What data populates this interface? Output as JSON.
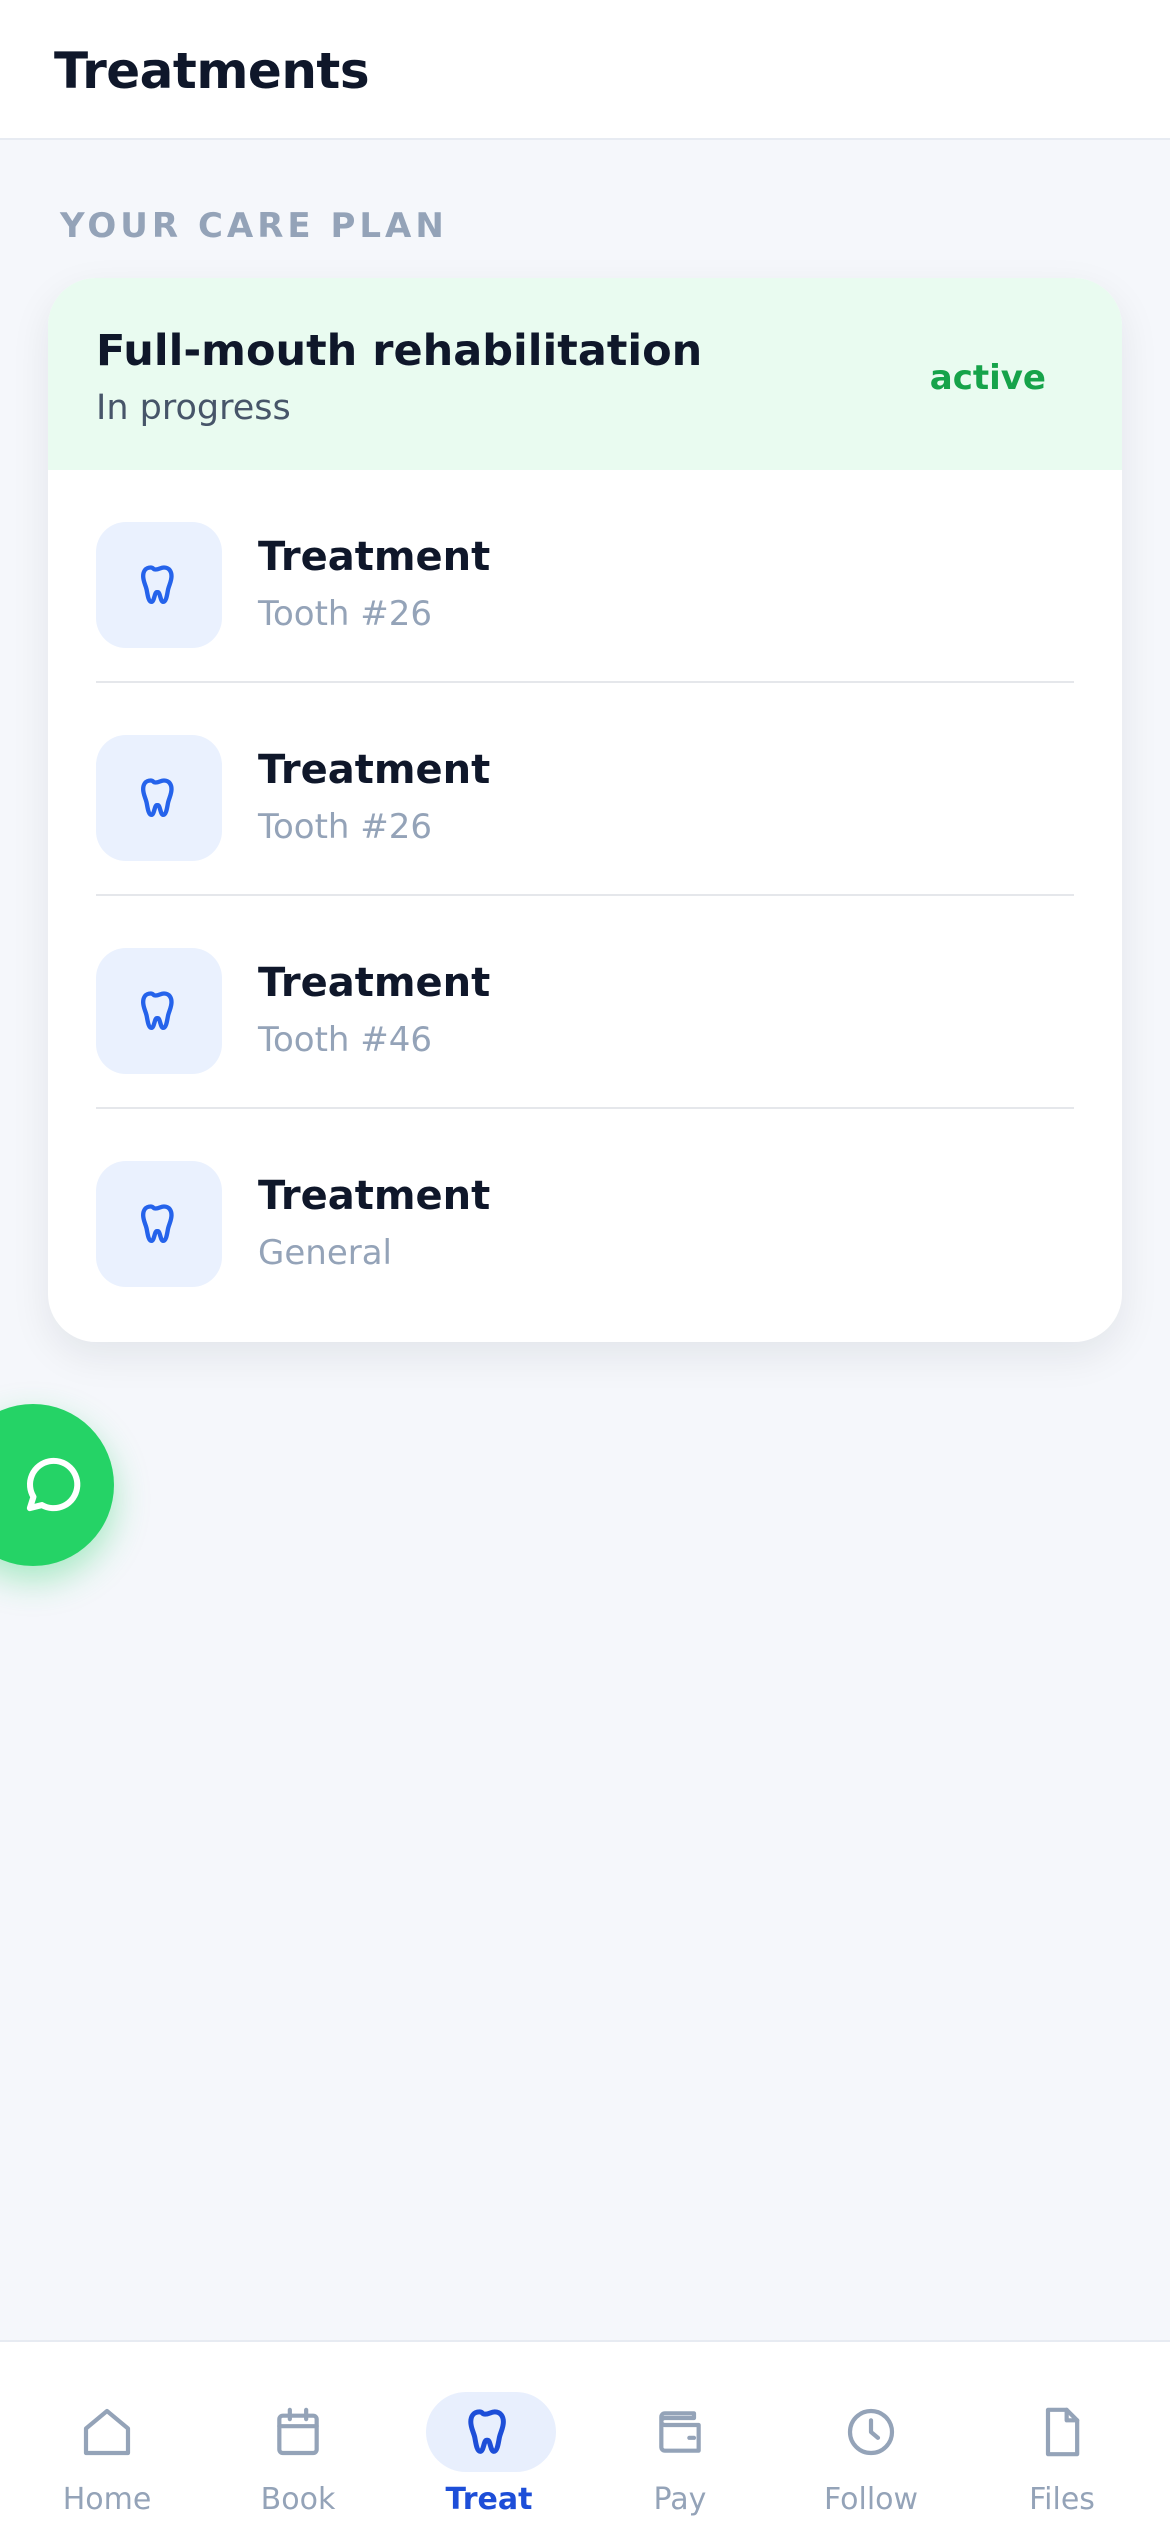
{
  "header": {
    "title": "Treatments"
  },
  "care_plan": {
    "section_label": "YOUR CARE PLAN",
    "name": "Full-mouth rehabilitation",
    "status": "In progress",
    "badge": "active",
    "items": [
      {
        "title": "Treatment",
        "subtitle": "Tooth #26",
        "icon": "tooth-icon"
      },
      {
        "title": "Treatment",
        "subtitle": "Tooth #26",
        "icon": "tooth-icon"
      },
      {
        "title": "Treatment",
        "subtitle": "Tooth #46",
        "icon": "tooth-icon"
      },
      {
        "title": "Treatment",
        "subtitle": "General",
        "icon": "tooth-icon"
      }
    ]
  },
  "chat_fab": {
    "icon": "chat-bubble-icon"
  },
  "nav": {
    "items": [
      {
        "label": "Home",
        "icon": "home-icon"
      },
      {
        "label": "Book",
        "icon": "calendar-icon"
      },
      {
        "label": "Treat",
        "icon": "tooth-icon",
        "active": true
      },
      {
        "label": "Pay",
        "icon": "wallet-icon"
      },
      {
        "label": "Follow",
        "icon": "clock-icon"
      },
      {
        "label": "Files",
        "icon": "file-icon"
      }
    ]
  },
  "colors": {
    "background": "#f5f7fb",
    "primary": "#1d4ed8",
    "success": "#16a34a",
    "whatsapp": "#25d366",
    "plan_header_bg": "#e9fbf0",
    "muted": "#94a3b8"
  }
}
